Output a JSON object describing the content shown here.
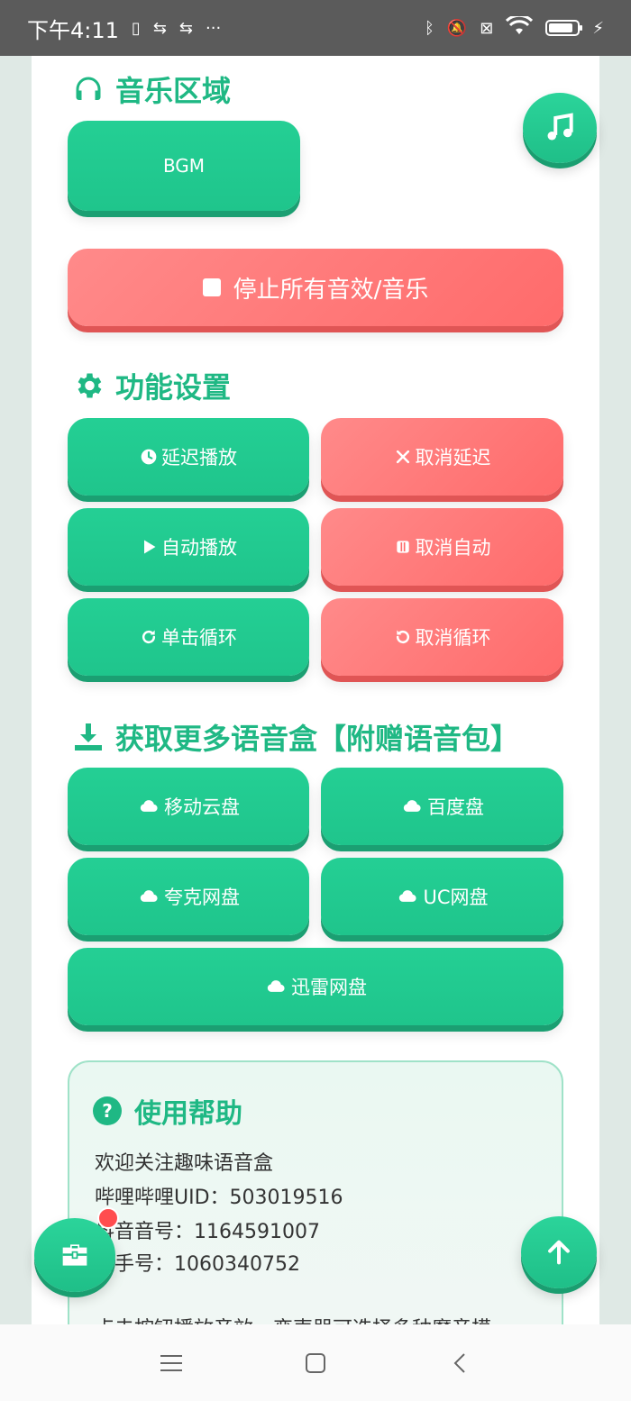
{
  "status_bar": {
    "time": "下午4:11",
    "icons": [
      "sim-icon",
      "usb-icon",
      "usb-icon",
      "more-icon",
      "bluetooth-icon",
      "mute-icon",
      "no-sim-icon",
      "wifi-icon",
      "battery-icon",
      "charging-icon"
    ],
    "dots": "···"
  },
  "music": {
    "title": "音乐区域",
    "bgm_label": "BGM",
    "stop_label": "停止所有音效/音乐"
  },
  "settings": {
    "title": "功能设置",
    "buttons": [
      {
        "label": "延迟播放",
        "icon": "clock-icon",
        "color": "#1fc58c"
      },
      {
        "label": "取消延迟",
        "icon": "close-icon",
        "color": "#ff6b6b"
      },
      {
        "label": "自动播放",
        "icon": "play-icon",
        "color": "#1fc58c"
      },
      {
        "label": "取消自动",
        "icon": "pause-icon",
        "color": "#ff6b6b"
      },
      {
        "label": "单击循环",
        "icon": "redo-icon",
        "color": "#1fc58c"
      },
      {
        "label": "取消循环",
        "icon": "undo-icon",
        "color": "#ff6b6b"
      }
    ]
  },
  "downloads": {
    "title": "获取更多语音盒【附赠语音包】",
    "buttons": [
      {
        "label": "移动云盘",
        "icon": "cloud-icon"
      },
      {
        "label": "百度盘",
        "icon": "cloud-icon"
      },
      {
        "label": "夸克网盘",
        "icon": "cloud-icon"
      },
      {
        "label": "UC网盘",
        "icon": "cloud-icon"
      },
      {
        "label": "迅雷网盘",
        "icon": "cloud-icon"
      }
    ]
  },
  "help": {
    "title": "使用帮助",
    "lines": [
      "欢迎关注趣味语音盒",
      "哔哩哔哩UID：503019516",
      "抖音音号：1164591007",
      "快手号：1060340752",
      "点击按钮播放音效，变声器可选择多种魔音模"
    ]
  },
  "colors": {
    "accent": "#1fc58c",
    "danger": "#ff6b6b",
    "badge": "#ff4d4f"
  }
}
